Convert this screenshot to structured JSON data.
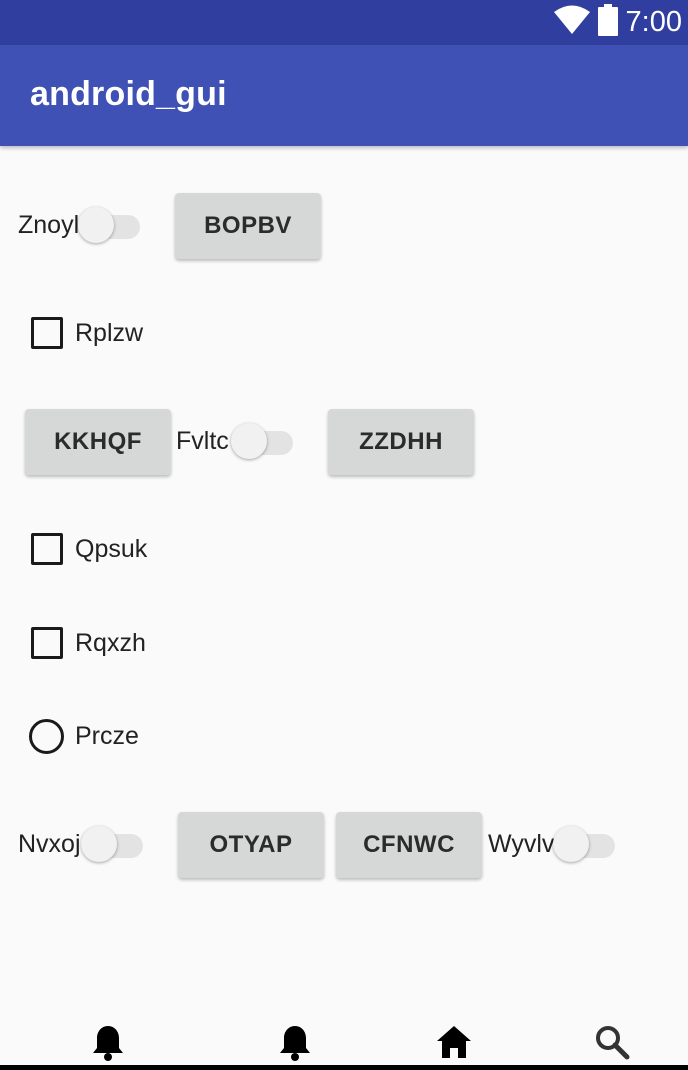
{
  "status_bar": {
    "time": "7:00",
    "icons": [
      "wifi-icon",
      "battery-icon"
    ]
  },
  "app_bar": {
    "title": "android_gui"
  },
  "rows": {
    "row1": {
      "switch_label": "Znoyl",
      "button_label": "BOPBV"
    },
    "row2": {
      "checkbox_label": "Rplzw"
    },
    "row3": {
      "button1_label": "KKHQF",
      "switch_label": "Fvltc",
      "button2_label": "ZZDHH"
    },
    "row4": {
      "checkbox_label": "Qpsuk"
    },
    "row5": {
      "checkbox_label": "Rqxzh"
    },
    "row6": {
      "radio_label": "Prcze"
    },
    "row7": {
      "switch1_label": "Nvxoj",
      "button1_label": "OTYAP",
      "button2_label": "CFNWC",
      "switch2_label": "Wyvlv"
    }
  },
  "bottom_nav": {
    "items": [
      "bell-icon",
      "bell-icon",
      "home-icon",
      "search-icon"
    ]
  },
  "colors": {
    "status_bar": "#303f9f",
    "app_bar": "#3f51b5",
    "background": "#fafafa",
    "button": "#d6d7d7"
  }
}
